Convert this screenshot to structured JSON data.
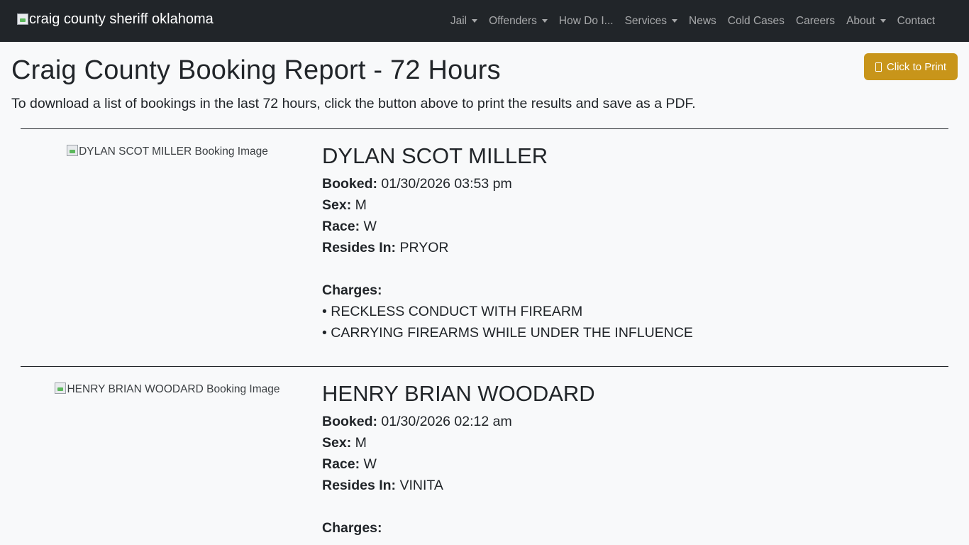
{
  "navbar": {
    "brand_alt": "craig county sheriff oklahoma",
    "items": [
      {
        "label": "Jail",
        "dropdown": true
      },
      {
        "label": "Offenders",
        "dropdown": true
      },
      {
        "label": "How Do I...",
        "dropdown": false
      },
      {
        "label": "Services",
        "dropdown": true
      },
      {
        "label": "News",
        "dropdown": false
      },
      {
        "label": "Cold Cases",
        "dropdown": false
      },
      {
        "label": "Careers",
        "dropdown": false
      },
      {
        "label": "About",
        "dropdown": true
      },
      {
        "label": "Contact",
        "dropdown": false
      }
    ]
  },
  "page": {
    "title": "Craig County Booking Report - 72 Hours",
    "print_label": "Click to Print",
    "intro": "To download a list of bookings in the last 72 hours, click the button above to print the results and save as a PDF."
  },
  "labels": {
    "booked": "Booked:",
    "sex": "Sex:",
    "race": "Race:",
    "resides": "Resides In:",
    "charges": "Charges:"
  },
  "bookings": [
    {
      "image_alt": "DYLAN SCOT MILLER Booking Image",
      "name": "DYLAN SCOT MILLER",
      "booked": "01/30/2026 03:53 pm",
      "sex": "M",
      "race": "W",
      "resides": "PRYOR",
      "charges": [
        "• RECKLESS CONDUCT WITH FIREARM",
        "• CARRYING FIREARMS WHILE UNDER THE INFLUENCE"
      ]
    },
    {
      "image_alt": "HENRY BRIAN WOODARD Booking Image",
      "name": "HENRY BRIAN WOODARD",
      "booked": "01/30/2026 02:12 am",
      "sex": "M",
      "race": "W",
      "resides": "VINITA",
      "charges": []
    }
  ]
}
